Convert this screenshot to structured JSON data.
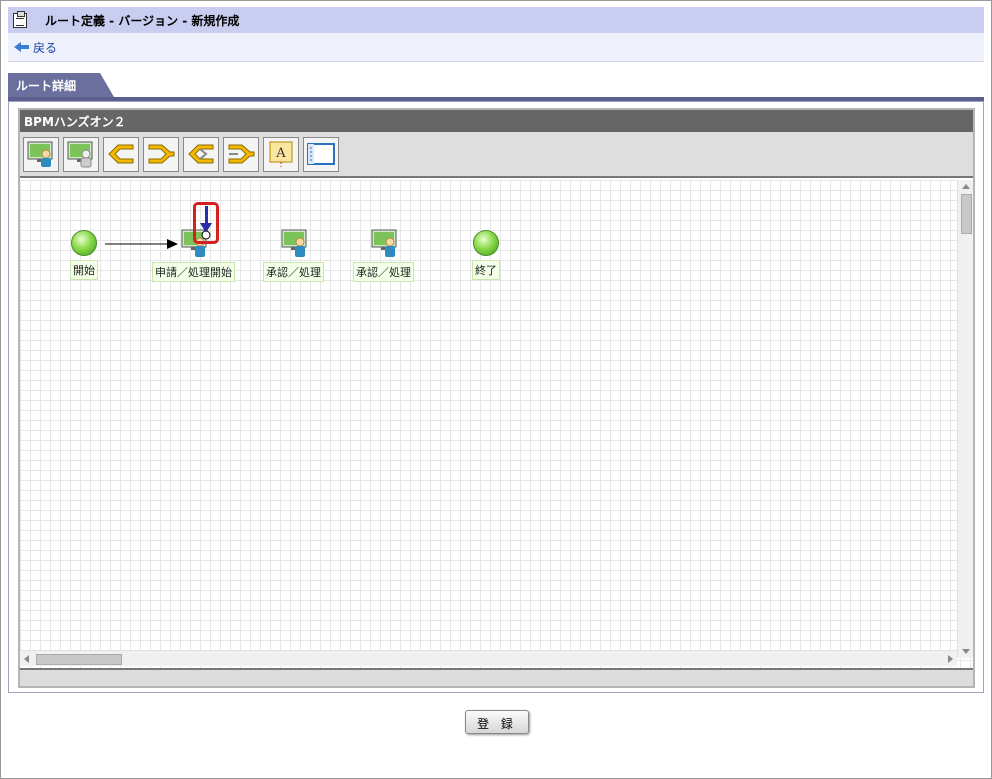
{
  "header": {
    "title": "ルート定義 - バージョン - 新規作成",
    "icon": "document-icon"
  },
  "nav": {
    "back_label": "戻る"
  },
  "tabs": [
    {
      "label": "ルート詳細",
      "active": true
    }
  ],
  "route": {
    "name": "BPMハンズオン２",
    "toolbar_tools": [
      "user-task-node-icon",
      "user-task-alt-node-icon",
      "branch-start-icon",
      "branch-end-icon",
      "parallel-start-icon",
      "parallel-end-icon",
      "text-annotation-icon",
      "form-icon"
    ],
    "nodes": [
      {
        "id": "start",
        "type": "start",
        "label": "開始"
      },
      {
        "id": "apply",
        "type": "user",
        "label": "申請／処理開始"
      },
      {
        "id": "approve1",
        "type": "user",
        "label": "承認／処理"
      },
      {
        "id": "approve2",
        "type": "user",
        "label": "承認／処理"
      },
      {
        "id": "end",
        "type": "end",
        "label": "終了"
      }
    ]
  },
  "footer": {
    "register_label": "登 録"
  },
  "colors": {
    "title_bg": "#c9cdf0",
    "tab_bg": "#6a6f9d",
    "highlight": "#d32020",
    "node_green": "#8bd94a"
  }
}
